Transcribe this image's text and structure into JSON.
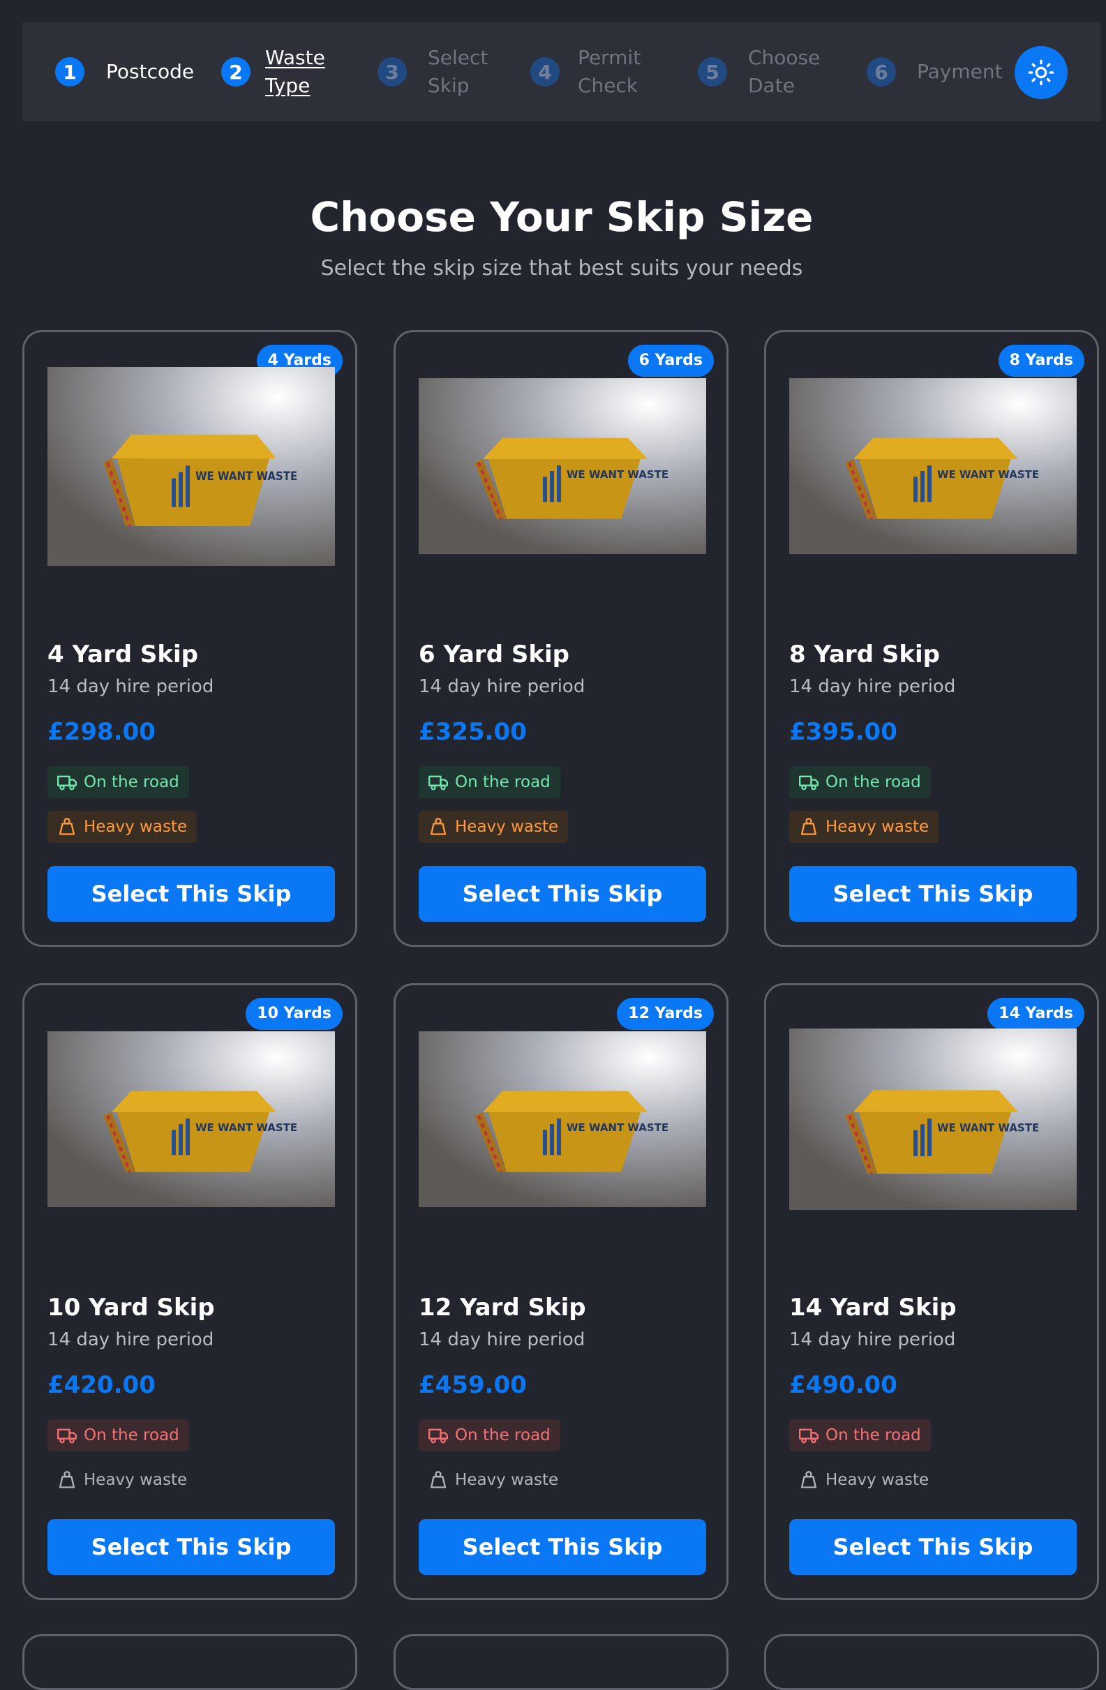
{
  "stepper": {
    "steps": [
      {
        "num": "1",
        "label": "Postcode"
      },
      {
        "num": "2",
        "label": "Waste Type"
      },
      {
        "num": "3",
        "label": "Select Skip"
      },
      {
        "num": "4",
        "label": "Permit Check"
      },
      {
        "num": "5",
        "label": "Choose Date"
      },
      {
        "num": "6",
        "label": "Payment"
      }
    ],
    "theme_icon": "sun-icon"
  },
  "header": {
    "title": "Choose Your Skip Size",
    "subtitle": "Select the skip size that best suits your needs"
  },
  "skips": [
    {
      "badge": "4 Yards",
      "title": "4 Yard Skip",
      "hire": "14 day hire period",
      "price": "£298.00",
      "road": "On the road",
      "road_allowed": true,
      "heavy": "Heavy waste",
      "heavy_allowed": true,
      "button": "Select This Skip",
      "logo": "WE WANT WASTE"
    },
    {
      "badge": "6 Yards",
      "title": "6 Yard Skip",
      "hire": "14 day hire period",
      "price": "£325.00",
      "road": "On the road",
      "road_allowed": true,
      "heavy": "Heavy waste",
      "heavy_allowed": true,
      "button": "Select This Skip",
      "logo": "WE WANT WASTE"
    },
    {
      "badge": "8 Yards",
      "title": "8 Yard Skip",
      "hire": "14 day hire period",
      "price": "£395.00",
      "road": "On the road",
      "road_allowed": true,
      "heavy": "Heavy waste",
      "heavy_allowed": true,
      "button": "Select This Skip",
      "logo": "WE WANT WASTE"
    },
    {
      "badge": "10 Yards",
      "title": "10 Yard Skip",
      "hire": "14 day hire period",
      "price": "£420.00",
      "road": "On the road",
      "road_allowed": false,
      "heavy": "Heavy waste",
      "heavy_allowed": false,
      "button": "Select This Skip",
      "logo": "WE WANT WASTE"
    },
    {
      "badge": "12 Yards",
      "title": "12 Yard Skip",
      "hire": "14 day hire period",
      "price": "£459.00",
      "road": "On the road",
      "road_allowed": false,
      "heavy": "Heavy waste",
      "heavy_allowed": false,
      "button": "Select This Skip",
      "logo": "WE WANT WASTE"
    },
    {
      "badge": "14 Yards",
      "title": "14 Yard Skip",
      "hire": "14 day hire period",
      "price": "£490.00",
      "road": "On the road",
      "road_allowed": false,
      "heavy": "Heavy waste",
      "heavy_allowed": false,
      "button": "Select This Skip",
      "logo": "WE WANT WASTE"
    }
  ],
  "colors": {
    "accent": "#0a78f5",
    "background": "#22252d",
    "road_ok": "#74e7b1",
    "road_no": "#f47276",
    "heavy_ok": "#ff9b3c"
  }
}
